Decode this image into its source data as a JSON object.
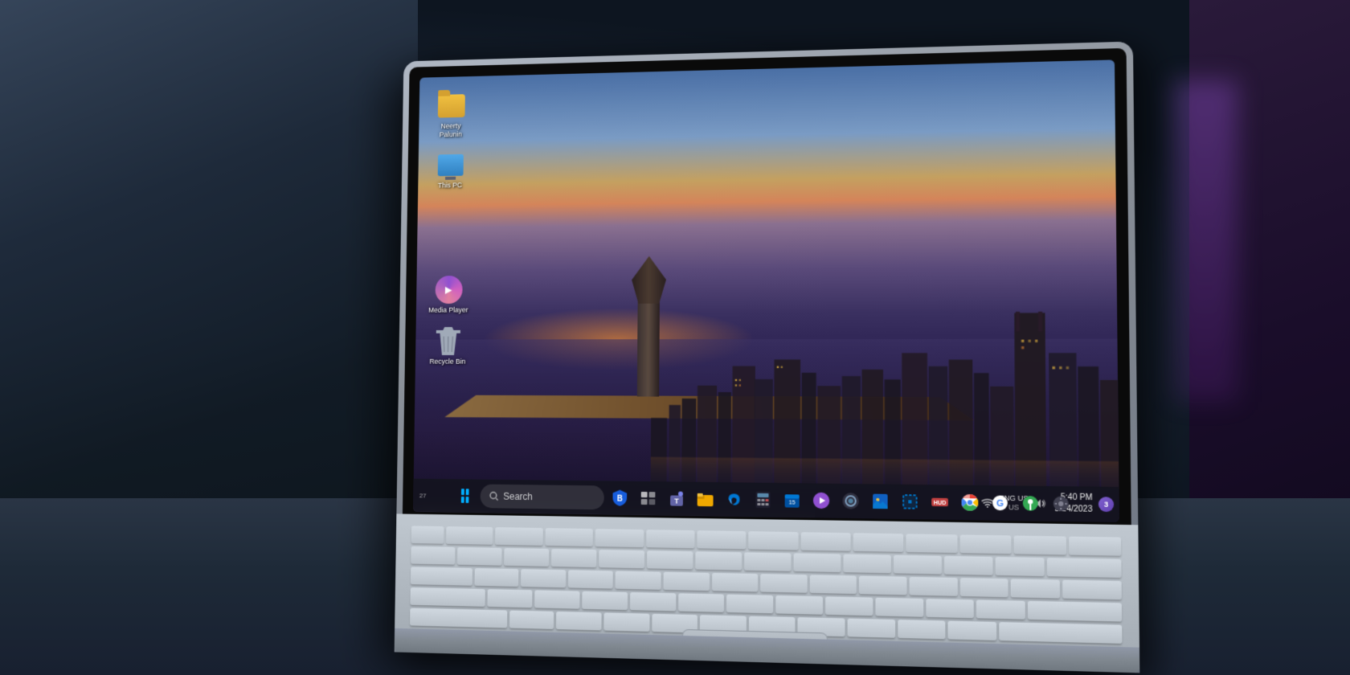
{
  "scene": {
    "background_color": "#0d1520",
    "description": "Laptop on table showing Windows 11 desktop"
  },
  "desktop": {
    "wallpaper_description": "Chicago cityscape at dusk with pier and lighthouse",
    "icons": [
      {
        "id": "folder",
        "label": "Neerty\nPalunin",
        "type": "folder"
      },
      {
        "id": "this-pc",
        "label": "This PC",
        "type": "computer"
      },
      {
        "id": "media-player",
        "label": "Media Player",
        "type": "media"
      },
      {
        "id": "recycle-bin",
        "label": "Recycle Bin",
        "type": "recycle"
      }
    ]
  },
  "taskbar": {
    "search_label": "Search",
    "start_button": "Windows Start",
    "apps": [
      {
        "id": "edge-app",
        "label": "Edge",
        "color": "#0078d4"
      },
      {
        "id": "bitwarden",
        "label": "Bitwarden",
        "color": "#175ddc"
      },
      {
        "id": "taskview",
        "label": "Task View",
        "color": "#ffffff"
      },
      {
        "id": "teams",
        "label": "Teams",
        "color": "#6264a7"
      },
      {
        "id": "explorer",
        "label": "File Explorer",
        "color": "#f0a800"
      },
      {
        "id": "edge2",
        "label": "Microsoft Edge",
        "color": "#0078d4"
      },
      {
        "id": "calculator",
        "label": "Calculator",
        "color": "#80d0ff"
      },
      {
        "id": "calendar",
        "label": "Calendar",
        "color": "#0078d4"
      },
      {
        "id": "media-tb",
        "label": "Media Player",
        "color": "#9050d0"
      },
      {
        "id": "obs",
        "label": "OBS",
        "color": "#484848"
      },
      {
        "id": "photos",
        "label": "Photos",
        "color": "#0078d4"
      },
      {
        "id": "snipping",
        "label": "Snipping Tool",
        "color": "#0070c0"
      },
      {
        "id": "settings2",
        "label": "Settings",
        "color": "#808080"
      },
      {
        "id": "app2",
        "label": "App",
        "color": "#c04040"
      },
      {
        "id": "chrome",
        "label": "Chrome",
        "color": "#ea4335"
      },
      {
        "id": "google2",
        "label": "Google",
        "color": "#4285f4"
      },
      {
        "id": "maps",
        "label": "Maps",
        "color": "#34a853"
      },
      {
        "id": "settings",
        "label": "Settings",
        "color": "#808080"
      }
    ],
    "system_tray": {
      "language": "ENG\nUS",
      "time": "5:40 PM",
      "date": "5/24/2023",
      "notifications_count": "3"
    }
  }
}
